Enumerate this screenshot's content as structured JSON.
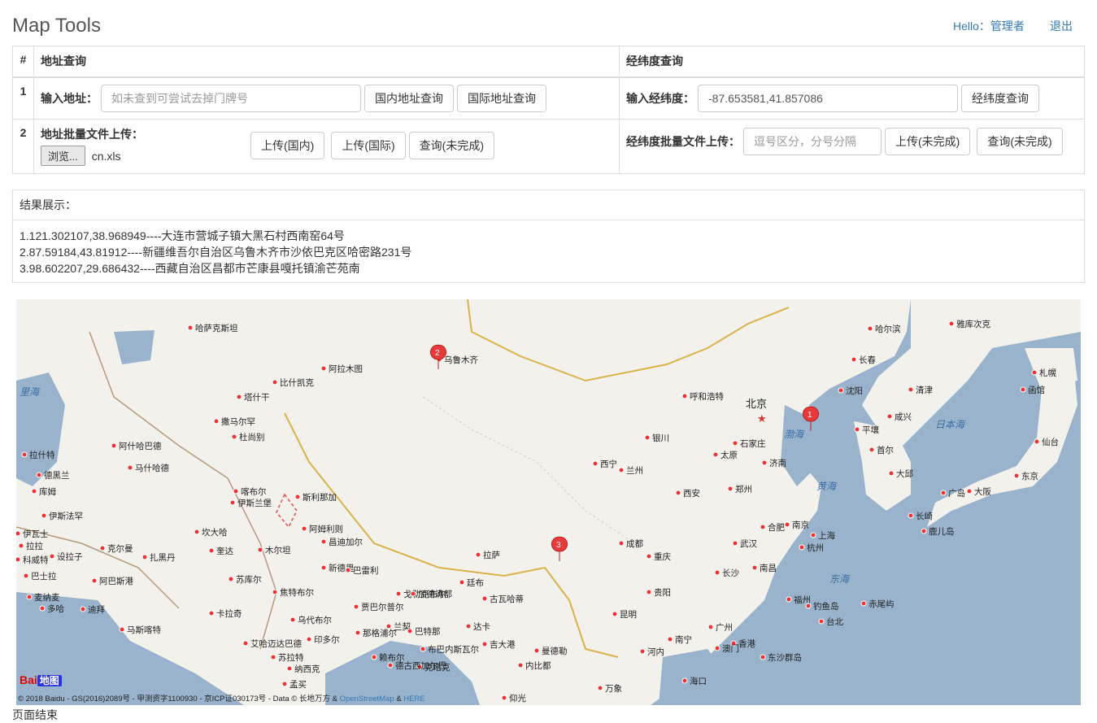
{
  "header": {
    "title": "Map Tools",
    "hello": "Hello：管理者",
    "logout": "退出"
  },
  "table": {
    "col_num": "#",
    "col_address": "地址查询",
    "col_latlng": "经纬度查询",
    "row1": {
      "num": "1",
      "address_label": "输入地址：",
      "address_placeholder": "如未查到可尝试去掉门牌号",
      "btn_domestic": "国内地址查询",
      "btn_international": "国际地址查询",
      "latlng_label": "输入经纬度：",
      "latlng_value": "-87.653581,41.857086",
      "btn_latlng": "经纬度查询"
    },
    "row2": {
      "num": "2",
      "upload_label": "地址批量文件上传：",
      "browse": "浏览...",
      "file_name": "cn.xls",
      "btn_upload_domestic": "上传(国内)",
      "btn_upload_international": "上传(国际)",
      "btn_query_unfinished": "查询(未完成)",
      "latlng_upload_label": "经纬度批量文件上传：",
      "latlng_placeholder": "逗号区分，分号分隔",
      "btn_latlng_upload": "上传(未完成)",
      "btn_latlng_query": "查询(未完成)"
    }
  },
  "results": {
    "heading": "结果展示：",
    "lines": [
      "1.121.302107,38.968949----大连市营城子镇大黑石村西南窑64号",
      "2.87.59184,43.81912----新疆维吾尔自治区乌鲁木齐市沙依巴克区哈密路231号",
      "3.98.602207,29.686432----西藏自治区昌都市芒康县嘎托镇渝芒苑南"
    ]
  },
  "map": {
    "markers": [
      "1",
      "2",
      "3"
    ],
    "capital": "北京",
    "cities": [
      "哈尔滨",
      "长春",
      "沈阳",
      "呼和浩特",
      "乌鲁木齐",
      "阿拉木图",
      "比什凯克",
      "塔什干",
      "撒马尔罕",
      "杜尚别",
      "阿什哈巴德",
      "马什哈德",
      "德黑兰",
      "库姆",
      "伊斯法罕",
      "喀布尔",
      "伊斯兰堡",
      "斯利那加",
      "阿姆利则",
      "昌迪加尔",
      "新德里",
      "巴雷利",
      "戈勒克布尔",
      "加德满都",
      "廷布",
      "古瓦哈蒂",
      "达卡",
      "吉大港",
      "曼德勒",
      "内比都",
      "仰光",
      "拉萨",
      "西宁",
      "兰州",
      "银川",
      "太原",
      "石家庄",
      "济南",
      "郑州",
      "西安",
      "成都",
      "重庆",
      "贵阳",
      "昆明",
      "南宁",
      "长沙",
      "武汉",
      "合肥",
      "南京",
      "上海",
      "杭州",
      "南昌",
      "福州",
      "台北",
      "广州",
      "香港",
      "澳门",
      "海口",
      "河内",
      "首尔",
      "平壤",
      "清津",
      "咸兴",
      "大邱",
      "广岛",
      "大阪",
      "东京",
      "仙台",
      "札幌",
      "函馆",
      "长崎",
      "鹿儿岛",
      "钓鱼岛",
      "赤尾屿",
      "东沙群岛",
      "拉什特",
      "伊瓦士",
      "拉拉",
      "坎大哈",
      "奎达",
      "木尔坦",
      "苏库尔",
      "焦特布尔",
      "卡拉奇",
      "乌代布尔",
      "印多尔",
      "艾哈迈达巴德",
      "那格浦尔",
      "赖布尔",
      "克塔克",
      "贾巴尔普尔",
      "兰契",
      "巴特那",
      "布巴内斯瓦尔",
      "德古西加尔巴",
      "设拉子",
      "扎黑丹",
      "克尔曼",
      "迪拜",
      "多哈",
      "马斯喀特",
      "麦纳麦",
      "科威特",
      "巴士拉",
      "哈萨克斯坦",
      "阿巴斯港",
      "雅库次克",
      "孟买",
      "纳西克",
      "苏拉特",
      "万象"
    ],
    "seas": [
      "里海",
      "渤海",
      "黄海",
      "东海",
      "日本海"
    ],
    "copyright": "© 2018 Baidu - GS(2016)2089号 - 甲测资字1100930 - 京ICP证030173号 - Data © 长地万方 &",
    "osm": "OpenStreetMap",
    "amp": "&",
    "here": "HERE",
    "logo_bai": "Bai",
    "logo_du": "地图"
  },
  "footer": "页面结束"
}
